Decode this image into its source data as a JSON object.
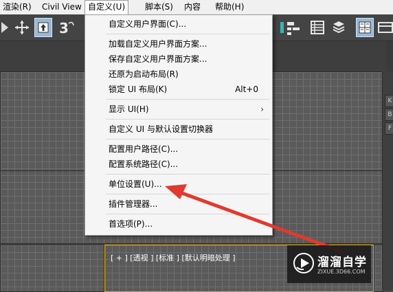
{
  "menubar": {
    "items": [
      {
        "label": "渲染(R)"
      },
      {
        "label": "Civil View"
      },
      {
        "label": "自定义(U)"
      },
      {
        "label": "脚本(S)"
      },
      {
        "label": "内容"
      },
      {
        "label": "帮助(H)"
      }
    ]
  },
  "toolbar": {
    "tools": [
      "align-icon",
      "move-icon",
      "select-icon",
      "snap-3d-icon",
      "layer-icon",
      "scene-explorer-icon",
      "table-icon",
      "stack-icon",
      "viewport-layout-icon"
    ]
  },
  "viewport": {
    "label": "[ + ] [透视 ] [标准 ] [默认明暗处理 ]",
    "active_border_color": "#e6a800"
  },
  "right_panel": {
    "tabs": [
      "K",
      "B",
      "F"
    ]
  },
  "dropdown": {
    "items": [
      {
        "label": "自定义用户界面(C)..."
      },
      {
        "label": "加载自定义用户界面方案..."
      },
      {
        "label": "保存自定义用户界面方案..."
      },
      {
        "label": "还原为启动布局(R)"
      },
      {
        "label": "锁定 UI 布局(K)",
        "shortcut": "Alt+0"
      },
      {
        "label": "显示 UI(H)",
        "submenu_arrow": "›"
      },
      {
        "label": "自定义 UI 与默认设置切换器"
      },
      {
        "label": "配置用户路径(C)..."
      },
      {
        "label": "配置系统路径(C)..."
      },
      {
        "label": "单位设置(U)..."
      },
      {
        "label": "插件管理器..."
      },
      {
        "label": "首选项(P)..."
      }
    ]
  },
  "annotation": {
    "color": "#e03a2f"
  },
  "watermark": {
    "title": "溜溜自学",
    "url": "ZIXUE.3D66.COM"
  }
}
